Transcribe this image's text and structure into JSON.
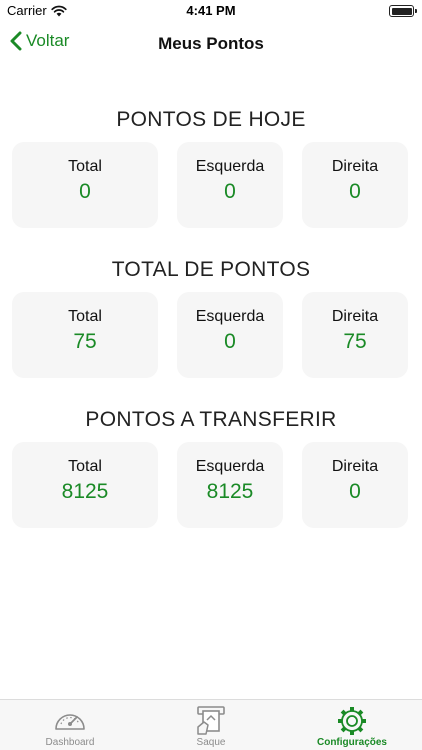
{
  "status_bar": {
    "carrier": "Carrier",
    "time": "4:41 PM"
  },
  "nav": {
    "back_label": "Voltar",
    "title": "Meus Pontos"
  },
  "sections": [
    {
      "title": "PONTOS DE HOJE",
      "cards": [
        {
          "label": "Total",
          "value": "0"
        },
        {
          "label": "Esquerda",
          "value": "0"
        },
        {
          "label": "Direita",
          "value": "0"
        }
      ]
    },
    {
      "title": "TOTAL DE PONTOS",
      "cards": [
        {
          "label": "Total",
          "value": "75"
        },
        {
          "label": "Esquerda",
          "value": "0"
        },
        {
          "label": "Direita",
          "value": "75"
        }
      ]
    },
    {
      "title": "PONTOS A TRANSFERIR",
      "cards": [
        {
          "label": "Total",
          "value": "8125"
        },
        {
          "label": "Esquerda",
          "value": "8125"
        },
        {
          "label": "Direita",
          "value": "0"
        }
      ]
    }
  ],
  "tab_bar": {
    "active": "Configurações",
    "items": [
      {
        "label": "Dashboard",
        "icon": "speedometer-icon"
      },
      {
        "label": "Saque",
        "icon": "atm-withdraw-icon"
      },
      {
        "label": "Configurações",
        "icon": "gear-icon"
      }
    ]
  },
  "colors": {
    "accent": "#1a8a26",
    "card_bg": "#f6f6f6",
    "tab_inactive": "#8c8c8c"
  }
}
